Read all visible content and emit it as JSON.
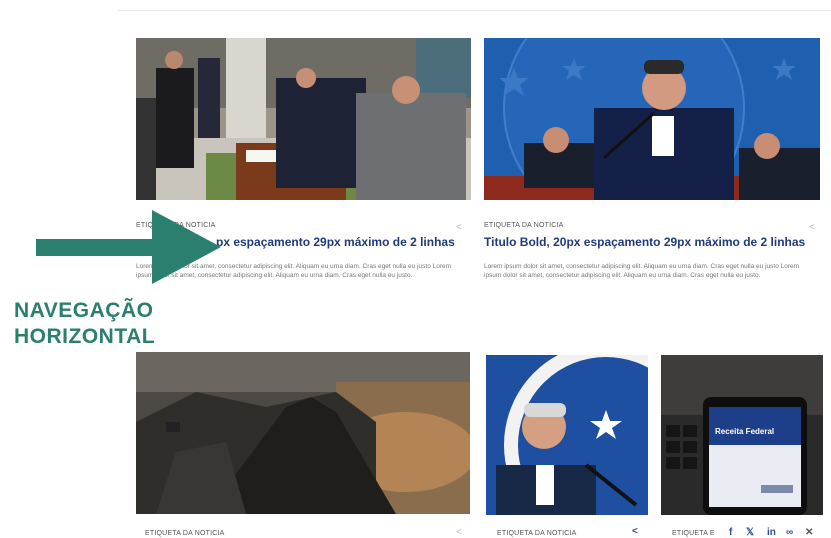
{
  "annotation": {
    "label_line1": "NAVEGAÇÃO",
    "label_line2": "HORIZONTAL",
    "color": "#2a7f6f"
  },
  "cards": [
    {
      "tag": "ETIQUETA DA NOTICIA",
      "title": "Titulo Bold, 20px espaçamento 29px máximo de 2 linhas",
      "visible_title": "px espaçamento 29px máximo de 2 linhas",
      "excerpt": "Lorem ipsum dolor sit amet, consectetur adipiscing elit. Aliquam eu urna diam. Cras eget nulla eu justo Lorem ipsum dolor sit amet, consectetur adipiscing elit. Aliquam eu urna diam. Cras eget nulla eu justo."
    },
    {
      "tag": "ETIQUETA DA NOTICIA",
      "title": "Titulo Bold, 20px espaçamento 29px máximo de 2 linhas",
      "excerpt": "Lorem ipsum dolor sit amet, consectetur adipiscing elit. Aliquam eu urna diam. Cras eget nulla eu justo Lorem ipsum dolor sit amet, consectetur adipiscing elit. Aliquam eu urna diam. Cras eget nulla eu justo."
    },
    {
      "tag": "ETIQUETA DA NOTICIA"
    },
    {
      "tag": "ETIQUETA DA NOTICIA"
    },
    {
      "tag": "ETIQUETA E"
    }
  ],
  "phone_screen": {
    "title": "Receita Federal"
  },
  "colors": {
    "title": "#1f3b7a",
    "share_active": "#2b4a9a"
  },
  "icons": [
    "share-icon",
    "facebook-icon",
    "twitter-icon",
    "linkedin-icon",
    "link-icon",
    "close-icon"
  ]
}
